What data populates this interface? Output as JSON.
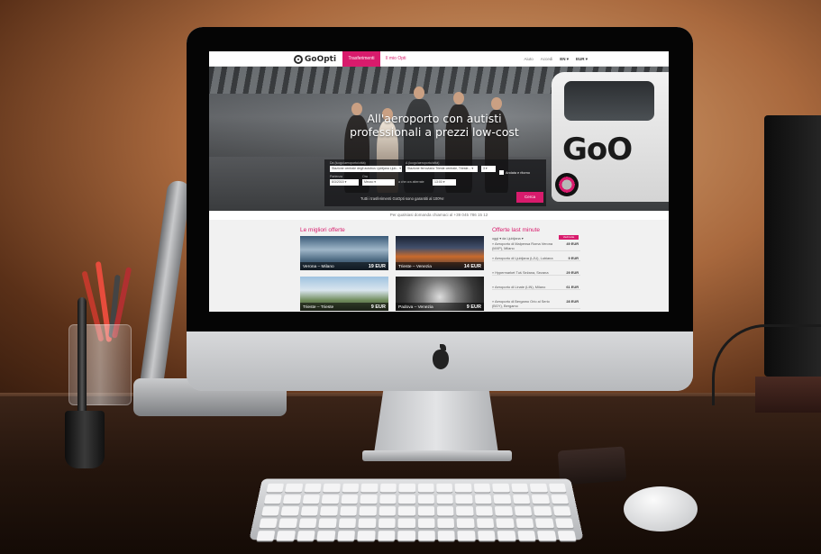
{
  "site": {
    "logo_text": "GoOpti",
    "nav": {
      "active_tab": "Trasferimenti",
      "second_tab": "Il mio Opti"
    },
    "top_right": {
      "help": "Aiuto",
      "login": "Accedi",
      "language": "EN ▾",
      "currency": "EUR ▾"
    },
    "hero": {
      "title": "All'aeroporto con autisti professionali a prezzi low-cost",
      "van_brand": "GoO"
    },
    "search_form": {
      "from_label": "Da (luogo/aeroporto/città)",
      "from_value": "Stazione centrale degli autobus Ljubljana Ljub...  ▾",
      "to_label": "A (luogo/aeroporto/città)",
      "to_value": "Stazione ferroviaria Trieste centrale, Trieste...  ▾",
      "passengers_value": "3  ▾",
      "return_label": "Andata e ritorno",
      "date_label": "Partenza",
      "date_value": "8/3/2015       ▾",
      "time_label": "Ora",
      "time_value": "Mezzo            ▾",
      "flight_label": "a che ora atterrate",
      "flight_value": "13:00        ▾",
      "guarantee": "Tutti i trasferimenti GoOpti sono garantiti al 100%!",
      "submit_label": "Cerca"
    },
    "info_strip": "Per qualsiasi domanda chiamaci al +39 045 786 15 12",
    "best_offers": {
      "title": "Le migliori offerte",
      "items": [
        {
          "route": "Verona – Milano",
          "price": "19 EUR"
        },
        {
          "route": "Trieste – Venezia",
          "price": "14 EUR"
        },
        {
          "route": "Trieste – Trieste",
          "price": "9 EUR"
        },
        {
          "route": "Padova – Venezia",
          "price": "9 EUR"
        }
      ]
    },
    "last_minute": {
      "title": "Offerte last minute",
      "filter": "oggi ▾  da Ljubljana ▾",
      "button": "Vedi tutte",
      "items": [
        {
          "name": "» Aeroporto di Malpensa Roma Verona (MXP), Milano",
          "price": "49 EUR"
        },
        {
          "name": "» Aeroporto di Ljubljana (LJU), Lubiana",
          "price": "9 EUR"
        },
        {
          "name": "» Hypermarket Tuš Sežana, Sezana",
          "price": "29 EUR"
        },
        {
          "name": "» Aeroporto di Linate (LIN), Milano",
          "price": "61 EUR"
        },
        {
          "name": "» Aeroporto di Bergamo Orio al Serio (BGY), Bergamo",
          "price": "28 EUR"
        }
      ]
    }
  },
  "colors": {
    "accent": "#d81b6c",
    "topbar_bg": "#ffffff",
    "panel_bg": "#141416"
  }
}
